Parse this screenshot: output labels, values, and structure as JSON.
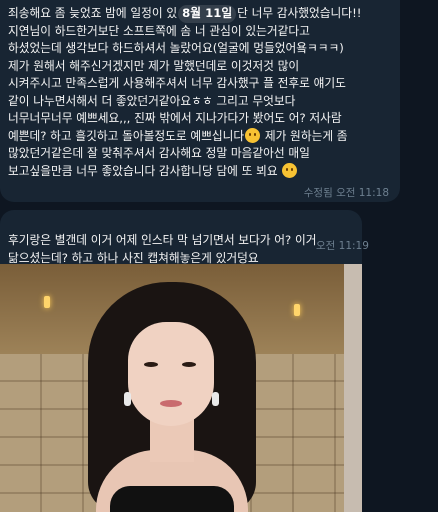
{
  "message1": {
    "line1_pre": "죄송해요 좀 늦었죠 밤에 일정이 있",
    "date_chip": "8월 11일",
    "line1_post": "단 너무 감사했었습니다!!",
    "line2": "지연님이 하드한거보단 소프트쪽에 솜 너 관심이 있는거같다고",
    "line3": "하셨었는데 생각보다 하드하셔서 놀랐어요(얼굴에 멍들었어욬ㅋㅋㅋ)",
    "line4": "제가 원해서 해주신거겠지만 제가 말했던데로 이것저것 많이",
    "line5": "시켜주시고 만족스럽게 사용해주셔서 너무 감사했구 플 전후로 얘기도",
    "line6": "같이 나누면서해서 더 좋았던거같아요ㅎㅎ 그리고 무엇보다",
    "line7": "너무너무너무 예쁘세요,,, 진짜 밖에서 지나가다가 봤어도 어? 저사람",
    "line8_pre": "예쁜데? 하고 흘깃하고 돌아볼정도로 예쁘십니다",
    "line8_post": " 제가 원하는게 좀",
    "line9": "많았던거같은데 잘 맞춰주셔서 감사해요 정말 마음같아선 매일",
    "line10_pre": "보고싶을만큼 너무 좋았습니다 감사합니당 담에 또 뵈요",
    "meta": "수정됨 오전 11:18",
    "emoji_names": [
      "smiling-face-emoji",
      "smiling-face-emoji"
    ]
  },
  "message2": {
    "line1": "후기랑은 별갠데 이거 어제 인스타 막 넘기면서 보다가 어? 이거",
    "line2": "닮으셨는데? 하고 하나 사진 캡쳐해놓은게 있거덩요",
    "meta": "오전 11:19",
    "photo_description_icon": "photo-attachment"
  },
  "colors": {
    "background": "#0e1621",
    "bubble": "#182533",
    "text": "#f5f5f5",
    "meta": "#6d7f8f"
  }
}
